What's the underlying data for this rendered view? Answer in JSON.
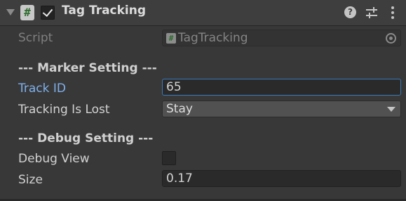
{
  "header": {
    "title": "Tag Tracking",
    "script_icon_glyph": "#",
    "help_glyph": "?",
    "enabled": true
  },
  "fields": {
    "script": {
      "label": "Script",
      "value": "TagTracking",
      "icon_glyph": "#"
    },
    "marker_section": "--- Marker Setting ---",
    "track_id": {
      "label": "Track ID",
      "value": "65"
    },
    "tracking_is_lost": {
      "label": "Tracking Is Lost",
      "value": "Stay"
    },
    "debug_section": "--- Debug Setting ---",
    "debug_view": {
      "label": "Debug View",
      "checked": false
    },
    "size": {
      "label": "Size",
      "value": "0.17"
    }
  },
  "colors": {
    "background": "#383838",
    "header": "#3e3e3e",
    "focus_border": "#3a79bb",
    "highlight_label": "#7fb0ec"
  },
  "icons": [
    "foldout-arrow-icon",
    "script-icon",
    "checkmark-icon",
    "help-icon",
    "presets-icon",
    "menu-icon",
    "object-picker-icon",
    "dropdown-arrow-icon"
  ]
}
